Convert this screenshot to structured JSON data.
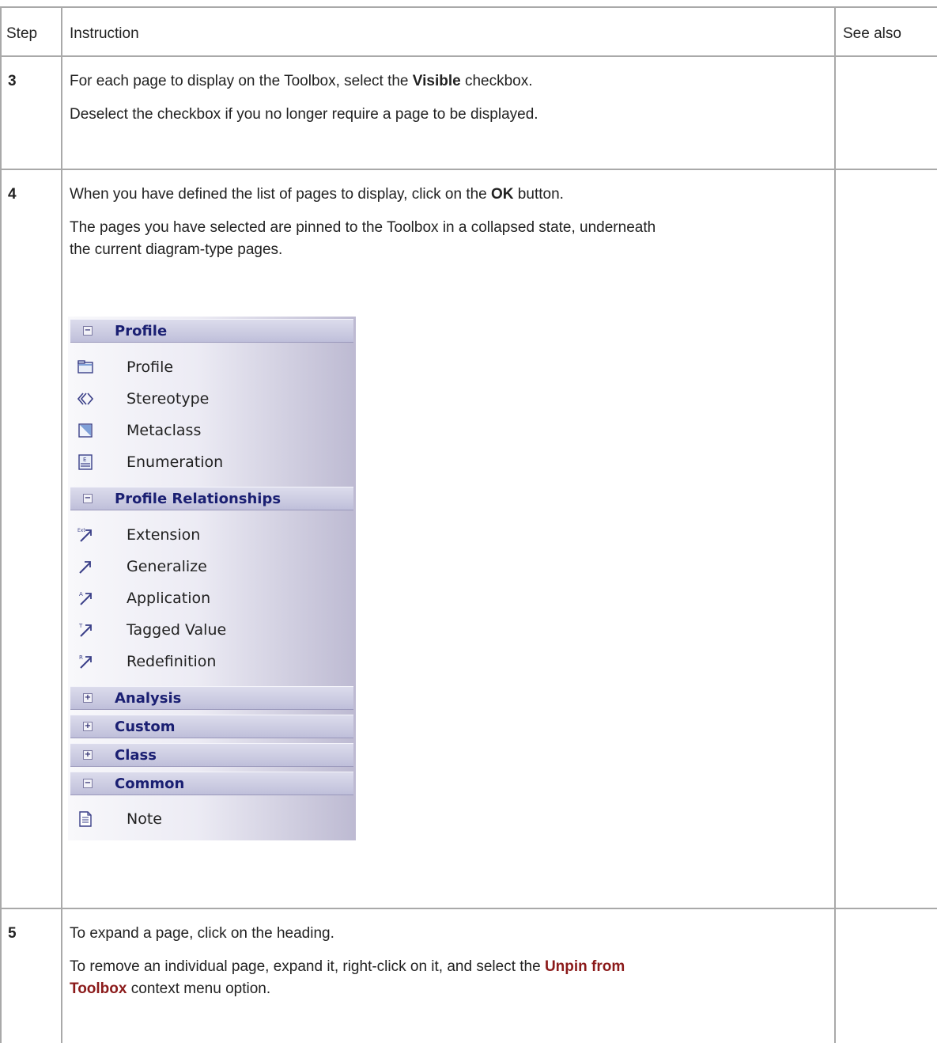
{
  "table": {
    "headers": {
      "step": "Step",
      "instruction": "Instruction",
      "see_also": "See also"
    },
    "rows": [
      {
        "step": "3",
        "line1_pre": "For each page to display on the Toolbox, select the ",
        "line1_bold": "Visible",
        "line1_post": " checkbox.",
        "line2": "Deselect the checkbox if you no longer require a page to be displayed."
      },
      {
        "step": "4",
        "line1_pre": "When you have defined the list of pages to display, click on the ",
        "line1_bold": "OK",
        "line1_post": " button.",
        "line2a": "The pages you have selected are pinned to the Toolbox in a collapsed state, underneath",
        "line2b": "the current diagram-type pages."
      },
      {
        "step": "5",
        "line1": "To expand a page, click on the heading.",
        "line2_pre": "To remove an individual page, expand it, right-click on it, and select the ",
        "line2_link_a": "Unpin from",
        "line2_link_b": "Toolbox",
        "line2_post": " context menu option."
      }
    ]
  },
  "toolbox": {
    "profile": {
      "title": "Profile",
      "toggle": "−",
      "items": [
        {
          "label": "Profile",
          "icon": "package-icon"
        },
        {
          "label": "Stereotype",
          "icon": "stereotype-icon"
        },
        {
          "label": "Metaclass",
          "icon": "metaclass-icon"
        },
        {
          "label": "Enumeration",
          "icon": "enumeration-icon"
        }
      ]
    },
    "profile_relationships": {
      "title": "Profile Relationships",
      "toggle": "−",
      "items": [
        {
          "label": "Extension",
          "icon": "extension-icon"
        },
        {
          "label": "Generalize",
          "icon": "generalize-icon"
        },
        {
          "label": "Application",
          "icon": "application-icon"
        },
        {
          "label": "Tagged Value",
          "icon": "tagged-value-icon"
        },
        {
          "label": "Redefinition",
          "icon": "redefinition-icon"
        }
      ]
    },
    "analysis": {
      "title": "Analysis",
      "toggle": "+"
    },
    "custom": {
      "title": "Custom",
      "toggle": "+"
    },
    "class": {
      "title": "Class",
      "toggle": "+"
    },
    "common": {
      "title": "Common",
      "toggle": "−",
      "items": [
        {
          "label": "Note",
          "icon": "note-icon"
        }
      ]
    },
    "icon_letters": {
      "extension": "Ext",
      "application": "A",
      "tagged": "T",
      "redefinition": "R",
      "enum": "E"
    }
  }
}
